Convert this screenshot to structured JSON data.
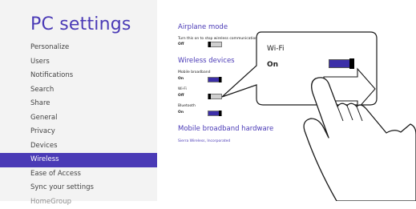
{
  "sidebar": {
    "title": "PC settings",
    "items": [
      {
        "label": "Personalize"
      },
      {
        "label": "Users"
      },
      {
        "label": "Notifications"
      },
      {
        "label": "Search"
      },
      {
        "label": "Share"
      },
      {
        "label": "General"
      },
      {
        "label": "Privacy"
      },
      {
        "label": "Devices"
      },
      {
        "label": "Wireless"
      },
      {
        "label": "Ease of Access"
      },
      {
        "label": "Sync your settings"
      },
      {
        "label": "HomeGroup"
      }
    ],
    "selected_index": 8
  },
  "airplane": {
    "title": "Airplane mode",
    "description": "Turn this on to stop wireless communication",
    "state": "Off"
  },
  "wireless_devices": {
    "title": "Wireless devices",
    "devices": [
      {
        "name": "Mobile broadband",
        "state": "On"
      },
      {
        "name": "Wi-Fi",
        "state": "Off"
      },
      {
        "name": "Bluetooth",
        "state": "On"
      }
    ]
  },
  "mobile_hw": {
    "title": "Mobile broadband hardware",
    "vendor": "Sierra Wireless, Incorporated"
  },
  "callout": {
    "label": "Wi-Fi",
    "state": "On"
  },
  "colors": {
    "accent": "#4a3ab6",
    "toggle_on": "#3c2fa8",
    "panel_bg": "#f3f3f3"
  }
}
